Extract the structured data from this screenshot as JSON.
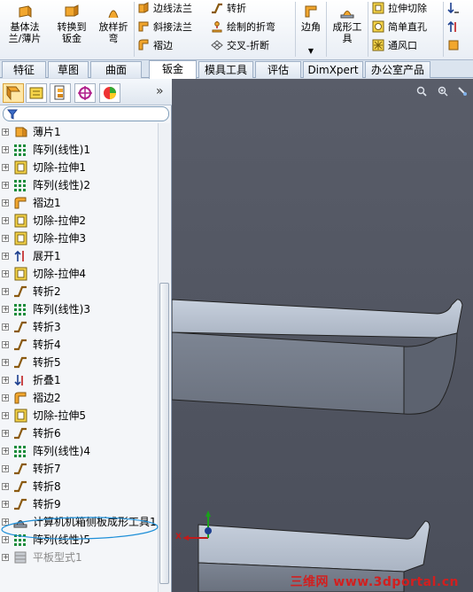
{
  "ribbon": {
    "base_flange": "基体法\n兰/薄片",
    "convert_to_sheet": "转换到\n钣金",
    "lofted_bend": "放样折\n弯",
    "edge_flange": "边线法兰",
    "miter_flange": "斜接法兰",
    "hem": "褶边",
    "jog": "转折",
    "sketched_bend": "绘制的折弯",
    "cross_break": "交叉-折断",
    "corners": "边角",
    "forming_tools": "成形工\n具",
    "extruded_cut": "拉伸切除",
    "simple_hole": "简单直孔",
    "vent": "通风口"
  },
  "tabs": [
    {
      "label": "特征"
    },
    {
      "label": "草图"
    },
    {
      "label": "曲面"
    },
    {
      "label": "钣金"
    },
    {
      "label": "模具工具"
    },
    {
      "label": "评估"
    },
    {
      "label": "DimXpert"
    },
    {
      "label": "办公室产品"
    }
  ],
  "active_tab": "钣金",
  "tree": [
    {
      "label": "薄片1",
      "icon": "base-flange-icon"
    },
    {
      "label": "阵列(线性)1",
      "icon": "linear-pattern-icon"
    },
    {
      "label": "切除-拉伸1",
      "icon": "cut-extrude-icon"
    },
    {
      "label": "阵列(线性)2",
      "icon": "linear-pattern-icon"
    },
    {
      "label": "褶边1",
      "icon": "hem-icon"
    },
    {
      "label": "切除-拉伸2",
      "icon": "cut-extrude-icon"
    },
    {
      "label": "切除-拉伸3",
      "icon": "cut-extrude-icon"
    },
    {
      "label": "展开1",
      "icon": "unfold-icon"
    },
    {
      "label": "切除-拉伸4",
      "icon": "cut-extrude-icon"
    },
    {
      "label": "转折2",
      "icon": "jog-icon"
    },
    {
      "label": "阵列(线性)3",
      "icon": "linear-pattern-icon"
    },
    {
      "label": "转折3",
      "icon": "jog-icon"
    },
    {
      "label": "转折4",
      "icon": "jog-icon"
    },
    {
      "label": "转折5",
      "icon": "jog-icon"
    },
    {
      "label": "折叠1",
      "icon": "fold-icon"
    },
    {
      "label": "褶边2",
      "icon": "hem-icon"
    },
    {
      "label": "切除-拉伸5",
      "icon": "cut-extrude-icon"
    },
    {
      "label": "转折6",
      "icon": "jog-icon"
    },
    {
      "label": "阵列(线性)4",
      "icon": "linear-pattern-icon"
    },
    {
      "label": "转折7",
      "icon": "jog-icon"
    },
    {
      "label": "转折8",
      "icon": "jog-icon"
    },
    {
      "label": "转折9",
      "icon": "jog-icon"
    },
    {
      "label": "计算机机箱侧板成形工具1",
      "icon": "forming-tool-icon"
    },
    {
      "label": "阵列(线性)5",
      "icon": "linear-pattern-icon"
    },
    {
      "label": "平板型式1",
      "icon": "flat-pattern-icon"
    }
  ],
  "triad": {
    "x_label": "X"
  },
  "watermark": "三维网 www.3dportal.cn",
  "colors": {
    "accent": "#d9a33d",
    "annotation_circle": "#1e8fd8",
    "viewport_bg": "#525662"
  }
}
